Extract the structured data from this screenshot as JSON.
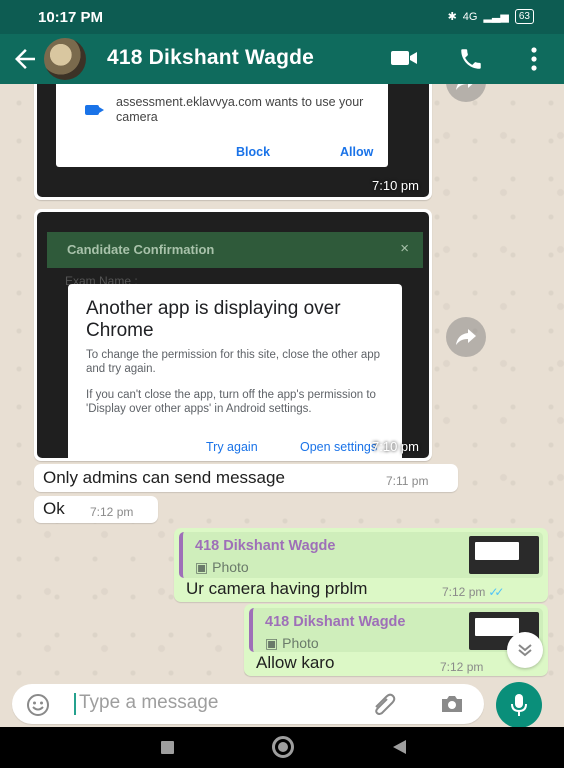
{
  "status": {
    "time": "10:17 PM",
    "network": "4G",
    "battery": "63"
  },
  "header": {
    "contact_name": "418 Dikshant Wagde"
  },
  "messages": {
    "image1": {
      "dialog_text": "assessment.eklavvya.com wants to use your camera",
      "block": "Block",
      "allow": "Allow",
      "time": "7:10 pm"
    },
    "image2": {
      "bar_title": "Candidate Confirmation",
      "bar_close": "×",
      "exam_label": "Exam Name :",
      "dialog_title": "Another app is displaying over Chrome",
      "para1": "To change the permission for this site, close the other app and try again.",
      "para2": "If you can't close the app, turn off the app's permission to 'Display over other apps' in Android settings.",
      "try_again": "Try again",
      "open_settings": "Open settings",
      "time": "7:10 pm"
    },
    "admins": {
      "text": "Only admins can send message",
      "time": "7:11 pm"
    },
    "ok": {
      "text": "Ok",
      "time": "7:12 pm"
    },
    "out1": {
      "quote_name": "418 Dikshant Wagde",
      "quote_type": "Photo",
      "text": "Ur camera having prblm",
      "time": "7:12 pm"
    },
    "out2": {
      "quote_name": "418 Dikshant Wagde",
      "quote_type": "Photo",
      "text": "Allow karo",
      "time": "7:12 pm"
    }
  },
  "composer": {
    "placeholder": "Type a message"
  },
  "colors": {
    "header": "#0f6b5d",
    "outgoing": "#dcf8c6",
    "accent": "#0a8f7a",
    "quote_name": "#9e6fb8"
  }
}
